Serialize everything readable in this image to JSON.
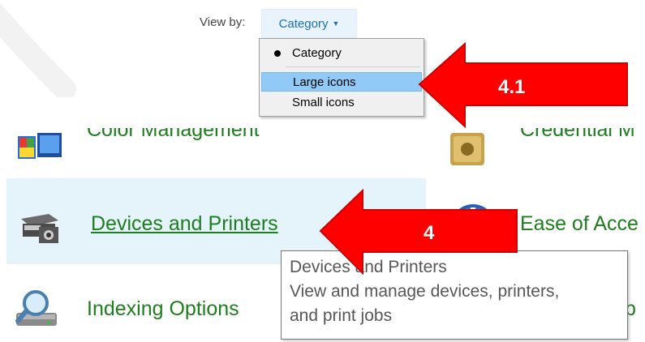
{
  "view_by": {
    "label": "View by:",
    "selected": "Category"
  },
  "menu": {
    "items": [
      "Category",
      "Large icons",
      "Small icons"
    ]
  },
  "items": {
    "color_management": "Color Management",
    "credential_manager": "Credential M",
    "devices_and_printers": "Devices and Printers",
    "ease_of_access": "Ease of Acce",
    "indexing_options": "Indexing Options",
    "partial_right": "p"
  },
  "tooltip": {
    "lines": [
      "Devices and Printers",
      "View and manage devices, printers,",
      "and print jobs"
    ]
  },
  "annotations": {
    "arrow1": "4.1",
    "arrow2": "4"
  },
  "colors": {
    "link_green": "#1e7d1e",
    "arrow_red": "#ff0000",
    "menu_highlight": "#91c9f7",
    "hover_bg": "#e5f3fb"
  }
}
